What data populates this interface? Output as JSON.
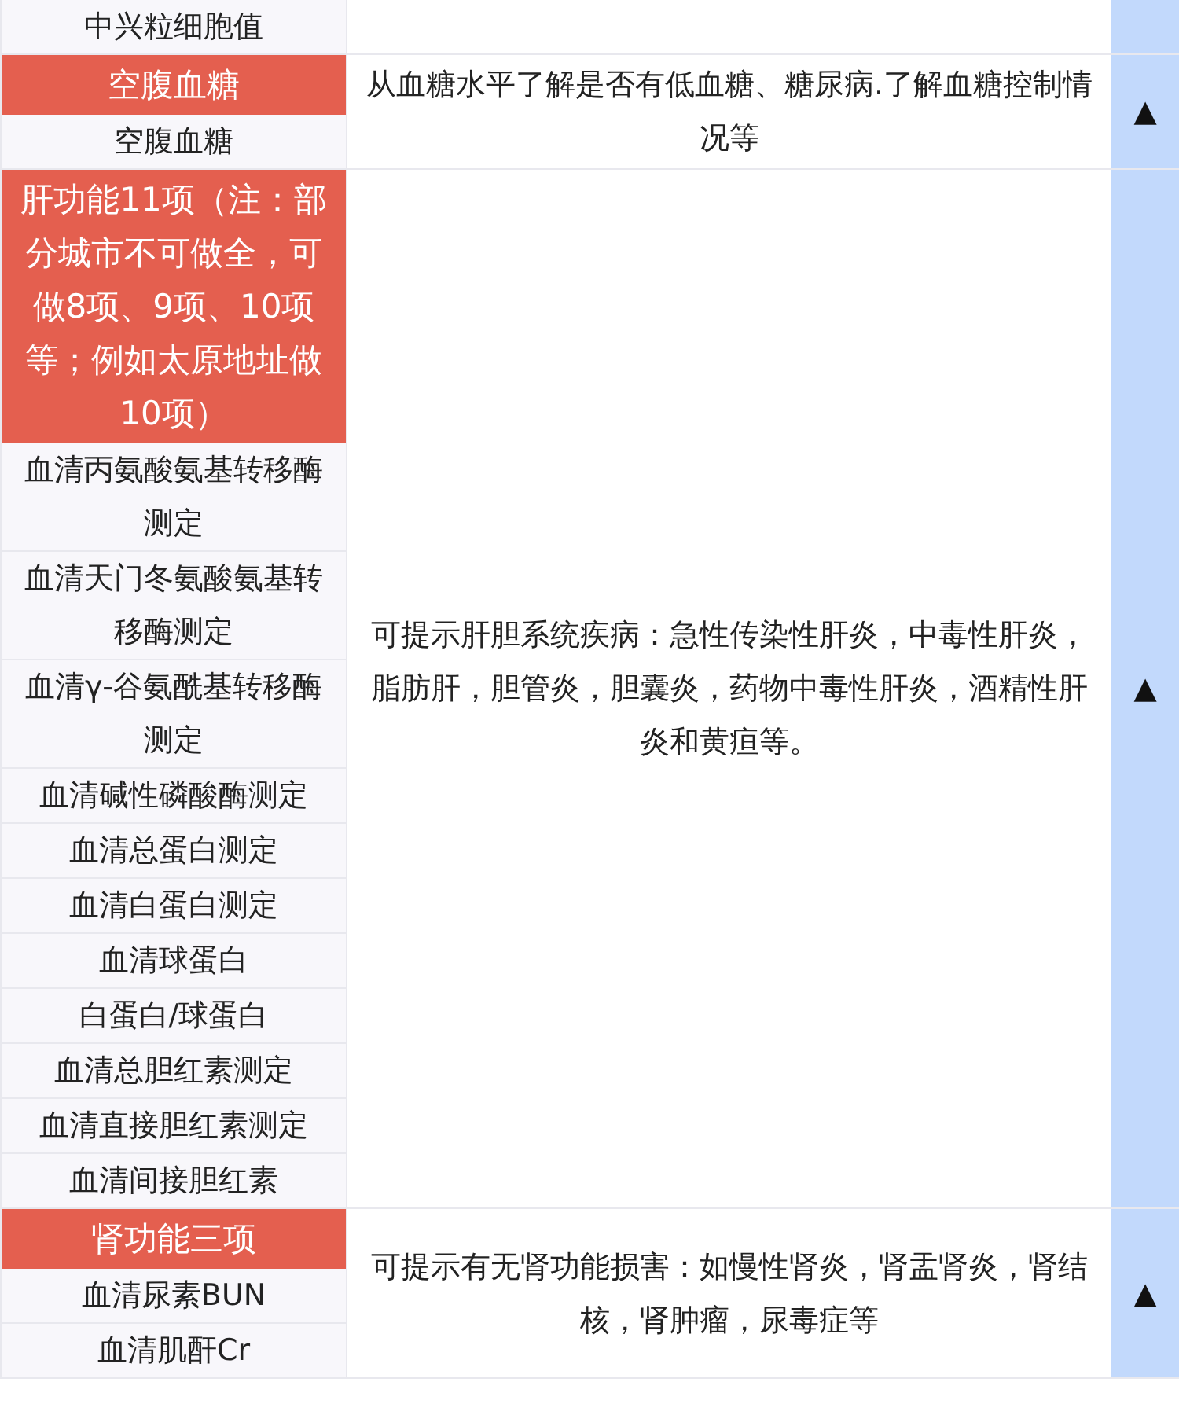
{
  "groups": [
    {
      "items": [
        "中兴粒细胞值"
      ]
    },
    {
      "title": "空腹血糖",
      "items": [
        "空腹血糖"
      ],
      "description": "从血糖水平了解是否有低血糖、糖尿病.了解血糖控制情况等",
      "toggle": "▲"
    },
    {
      "title": "肝功能11项（注：部分城市不可做全，可做8项、9项、10项等；例如太原地址做10项）",
      "items": [
        "血清丙氨酸氨基转移酶测定",
        "血清天门冬氨酸氨基转移酶测定",
        "血清γ-谷氨酰基转移酶测定",
        "血清碱性磷酸酶测定",
        "血清总蛋白测定",
        "血清白蛋白测定",
        "血清球蛋白",
        "白蛋白/球蛋白",
        "血清总胆红素测定",
        "血清直接胆红素测定",
        "血清间接胆红素"
      ],
      "description": "可提示肝胆系统疾病：急性传染性肝炎，中毒性肝炎，脂肪肝，胆管炎，胆囊炎，药物中毒性肝炎，酒精性肝炎和黄疸等。",
      "toggle": "▲"
    },
    {
      "title": "肾功能三项",
      "items": [
        "血清尿素BUN",
        "血清肌酐Cr"
      ],
      "description": "可提示有无肾功能损害：如慢性肾炎，肾盂肾炎，肾结核，肾肿瘤，尿毒症等",
      "toggle": "▲"
    }
  ]
}
